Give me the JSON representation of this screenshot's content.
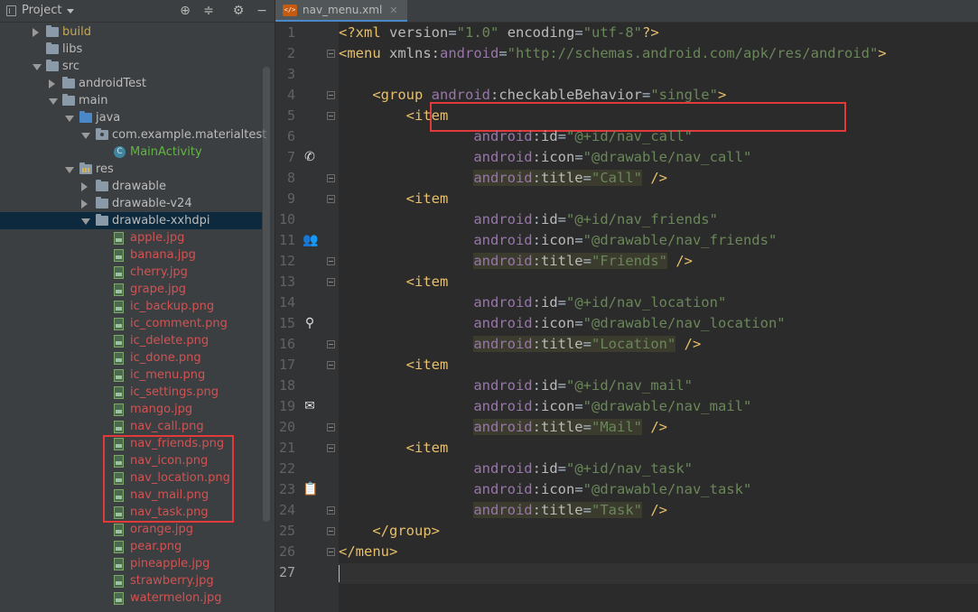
{
  "project_panel": {
    "title": "Project",
    "toolbar_icons": [
      "target-icon",
      "collapse-icon",
      "gear-icon",
      "hide-icon"
    ],
    "tree": [
      {
        "label": "build",
        "depth": 1,
        "arrow": "right",
        "icon": "folder",
        "color": "build"
      },
      {
        "label": "libs",
        "depth": 1,
        "arrow": "none",
        "icon": "folder",
        "color": "normal"
      },
      {
        "label": "src",
        "depth": 1,
        "arrow": "down",
        "icon": "folder",
        "color": "normal"
      },
      {
        "label": "androidTest",
        "depth": 2,
        "arrow": "right",
        "icon": "folder",
        "color": "normal"
      },
      {
        "label": "main",
        "depth": 2,
        "arrow": "down",
        "icon": "folder",
        "color": "normal"
      },
      {
        "label": "java",
        "depth": 3,
        "arrow": "down",
        "icon": "folder-blue",
        "color": "normal"
      },
      {
        "label": "com.example.materialtest",
        "depth": 4,
        "arrow": "down",
        "icon": "package",
        "color": "normal"
      },
      {
        "label": "MainActivity",
        "depth": 5,
        "arrow": "none",
        "icon": "class",
        "color": "green"
      },
      {
        "label": "res",
        "depth": 3,
        "arrow": "down",
        "icon": "folder-res",
        "color": "normal"
      },
      {
        "label": "drawable",
        "depth": 4,
        "arrow": "right",
        "icon": "folder",
        "color": "normal"
      },
      {
        "label": "drawable-v24",
        "depth": 4,
        "arrow": "right",
        "icon": "folder",
        "color": "normal"
      },
      {
        "label": "drawable-xxhdpi",
        "depth": 4,
        "arrow": "down",
        "icon": "folder",
        "color": "normal",
        "selected": true
      },
      {
        "label": "apple.jpg",
        "depth": 5,
        "arrow": "none",
        "icon": "image",
        "color": "file"
      },
      {
        "label": "banana.jpg",
        "depth": 5,
        "arrow": "none",
        "icon": "image",
        "color": "file"
      },
      {
        "label": "cherry.jpg",
        "depth": 5,
        "arrow": "none",
        "icon": "image",
        "color": "file"
      },
      {
        "label": "grape.jpg",
        "depth": 5,
        "arrow": "none",
        "icon": "image",
        "color": "file"
      },
      {
        "label": "ic_backup.png",
        "depth": 5,
        "arrow": "none",
        "icon": "image",
        "color": "file"
      },
      {
        "label": "ic_comment.png",
        "depth": 5,
        "arrow": "none",
        "icon": "image",
        "color": "file"
      },
      {
        "label": "ic_delete.png",
        "depth": 5,
        "arrow": "none",
        "icon": "image",
        "color": "file"
      },
      {
        "label": "ic_done.png",
        "depth": 5,
        "arrow": "none",
        "icon": "image",
        "color": "file"
      },
      {
        "label": "ic_menu.png",
        "depth": 5,
        "arrow": "none",
        "icon": "image",
        "color": "file"
      },
      {
        "label": "ic_settings.png",
        "depth": 5,
        "arrow": "none",
        "icon": "image",
        "color": "file"
      },
      {
        "label": "mango.jpg",
        "depth": 5,
        "arrow": "none",
        "icon": "image",
        "color": "file"
      },
      {
        "label": "nav_call.png",
        "depth": 5,
        "arrow": "none",
        "icon": "image",
        "color": "file"
      },
      {
        "label": "nav_friends.png",
        "depth": 5,
        "arrow": "none",
        "icon": "image",
        "color": "file"
      },
      {
        "label": "nav_icon.png",
        "depth": 5,
        "arrow": "none",
        "icon": "image",
        "color": "file"
      },
      {
        "label": "nav_location.png",
        "depth": 5,
        "arrow": "none",
        "icon": "image",
        "color": "file"
      },
      {
        "label": "nav_mail.png",
        "depth": 5,
        "arrow": "none",
        "icon": "image",
        "color": "file"
      },
      {
        "label": "nav_task.png",
        "depth": 5,
        "arrow": "none",
        "icon": "image",
        "color": "file"
      },
      {
        "label": "orange.jpg",
        "depth": 5,
        "arrow": "none",
        "icon": "image",
        "color": "file"
      },
      {
        "label": "pear.png",
        "depth": 5,
        "arrow": "none",
        "icon": "image",
        "color": "file"
      },
      {
        "label": "pineapple.jpg",
        "depth": 5,
        "arrow": "none",
        "icon": "image",
        "color": "file"
      },
      {
        "label": "strawberry.jpg",
        "depth": 5,
        "arrow": "none",
        "icon": "image",
        "color": "file"
      },
      {
        "label": "watermelon.jpg",
        "depth": 5,
        "arrow": "none",
        "icon": "image",
        "color": "file"
      }
    ]
  },
  "editor": {
    "tab": {
      "label": "nav_menu.xml",
      "icon": "xml-file-icon"
    },
    "current_line": 27,
    "lines": [
      {
        "n": 1,
        "segs": [
          [
            "p",
            "<?xml "
          ],
          [
            "a",
            "version"
          ],
          [
            "g",
            "="
          ],
          [
            "v",
            "\"1.0\""
          ],
          [
            "g",
            " "
          ],
          [
            "a",
            "encoding"
          ],
          [
            "g",
            "="
          ],
          [
            "v",
            "\"utf-8\""
          ],
          [
            "p",
            "?>"
          ]
        ]
      },
      {
        "n": 2,
        "fold": true,
        "segs": [
          [
            "t",
            "<menu "
          ],
          [
            "a",
            "xmlns:"
          ],
          [
            "ns",
            "android"
          ],
          [
            "g",
            "="
          ],
          [
            "v",
            "\"http://schemas.android.com/apk/res/android\""
          ],
          [
            "t",
            ">"
          ]
        ]
      },
      {
        "n": 3,
        "segs": []
      },
      {
        "n": 4,
        "fold": true,
        "segs": [
          [
            "g",
            "    "
          ],
          [
            "t",
            "<group "
          ],
          [
            "ns",
            "android"
          ],
          [
            "g",
            ":"
          ],
          [
            "a",
            "checkableBehavior"
          ],
          [
            "g",
            "="
          ],
          [
            "v",
            "\"single\""
          ],
          [
            "t",
            ">"
          ]
        ]
      },
      {
        "n": 5,
        "fold": true,
        "segs": [
          [
            "g",
            "        "
          ],
          [
            "t",
            "<item"
          ]
        ]
      },
      {
        "n": 6,
        "segs": [
          [
            "g",
            "                "
          ],
          [
            "ns",
            "android"
          ],
          [
            "g",
            ":"
          ],
          [
            "a",
            "id"
          ],
          [
            "g",
            "="
          ],
          [
            "v",
            "\"@+id/nav_call\""
          ]
        ]
      },
      {
        "n": 7,
        "icon": "phone-icon",
        "segs": [
          [
            "g",
            "                "
          ],
          [
            "ns",
            "android"
          ],
          [
            "g",
            ":"
          ],
          [
            "a",
            "icon"
          ],
          [
            "g",
            "="
          ],
          [
            "v",
            "\"@drawable/nav_call\""
          ]
        ]
      },
      {
        "n": 8,
        "fold": true,
        "segs": [
          [
            "g",
            "                "
          ],
          [
            "hl",
            "android:title=\"Call\""
          ],
          [
            "g",
            " "
          ],
          [
            "t",
            "/>"
          ]
        ],
        "title_attr": "Call"
      },
      {
        "n": 9,
        "fold": true,
        "segs": [
          [
            "g",
            "        "
          ],
          [
            "t",
            "<item"
          ]
        ]
      },
      {
        "n": 10,
        "segs": [
          [
            "g",
            "                "
          ],
          [
            "ns",
            "android"
          ],
          [
            "g",
            ":"
          ],
          [
            "a",
            "id"
          ],
          [
            "g",
            "="
          ],
          [
            "v",
            "\"@+id/nav_friends\""
          ]
        ]
      },
      {
        "n": 11,
        "icon": "people-icon",
        "segs": [
          [
            "g",
            "                "
          ],
          [
            "ns",
            "android"
          ],
          [
            "g",
            ":"
          ],
          [
            "a",
            "icon"
          ],
          [
            "g",
            "="
          ],
          [
            "v",
            "\"@drawable/nav_friends\""
          ]
        ]
      },
      {
        "n": 12,
        "fold": true,
        "segs": [
          [
            "g",
            "                "
          ],
          [
            "hl",
            "android:title=\"Friends\""
          ],
          [
            "g",
            " "
          ],
          [
            "t",
            "/>"
          ]
        ],
        "title_attr": "Friends"
      },
      {
        "n": 13,
        "fold": true,
        "segs": [
          [
            "g",
            "        "
          ],
          [
            "t",
            "<item"
          ]
        ]
      },
      {
        "n": 14,
        "segs": [
          [
            "g",
            "                "
          ],
          [
            "ns",
            "android"
          ],
          [
            "g",
            ":"
          ],
          [
            "a",
            "id"
          ],
          [
            "g",
            "="
          ],
          [
            "v",
            "\"@+id/nav_location\""
          ]
        ]
      },
      {
        "n": 15,
        "icon": "location-pin-icon",
        "segs": [
          [
            "g",
            "                "
          ],
          [
            "ns",
            "android"
          ],
          [
            "g",
            ":"
          ],
          [
            "a",
            "icon"
          ],
          [
            "g",
            "="
          ],
          [
            "v",
            "\"@drawable/nav_location\""
          ]
        ]
      },
      {
        "n": 16,
        "fold": true,
        "segs": [
          [
            "g",
            "                "
          ],
          [
            "hl",
            "android:title=\"Location\""
          ],
          [
            "g",
            " "
          ],
          [
            "t",
            "/>"
          ]
        ],
        "title_attr": "Location"
      },
      {
        "n": 17,
        "fold": true,
        "segs": [
          [
            "g",
            "        "
          ],
          [
            "t",
            "<item"
          ]
        ]
      },
      {
        "n": 18,
        "segs": [
          [
            "g",
            "                "
          ],
          [
            "ns",
            "android"
          ],
          [
            "g",
            ":"
          ],
          [
            "a",
            "id"
          ],
          [
            "g",
            "="
          ],
          [
            "v",
            "\"@+id/nav_mail\""
          ]
        ]
      },
      {
        "n": 19,
        "icon": "mail-icon",
        "segs": [
          [
            "g",
            "                "
          ],
          [
            "ns",
            "android"
          ],
          [
            "g",
            ":"
          ],
          [
            "a",
            "icon"
          ],
          [
            "g",
            "="
          ],
          [
            "v",
            "\"@drawable/nav_mail\""
          ]
        ]
      },
      {
        "n": 20,
        "fold": true,
        "segs": [
          [
            "g",
            "                "
          ],
          [
            "hl",
            "android:title=\"Mail\""
          ],
          [
            "g",
            " "
          ],
          [
            "t",
            "/>"
          ]
        ],
        "title_attr": "Mail"
      },
      {
        "n": 21,
        "fold": true,
        "segs": [
          [
            "g",
            "        "
          ],
          [
            "t",
            "<item"
          ]
        ]
      },
      {
        "n": 22,
        "segs": [
          [
            "g",
            "                "
          ],
          [
            "ns",
            "android"
          ],
          [
            "g",
            ":"
          ],
          [
            "a",
            "id"
          ],
          [
            "g",
            "="
          ],
          [
            "v",
            "\"@+id/nav_task\""
          ]
        ]
      },
      {
        "n": 23,
        "icon": "clipboard-icon",
        "segs": [
          [
            "g",
            "                "
          ],
          [
            "ns",
            "android"
          ],
          [
            "g",
            ":"
          ],
          [
            "a",
            "icon"
          ],
          [
            "g",
            "="
          ],
          [
            "v",
            "\"@drawable/nav_task\""
          ]
        ]
      },
      {
        "n": 24,
        "fold": true,
        "segs": [
          [
            "g",
            "                "
          ],
          [
            "hl",
            "android:title=\"Task\""
          ],
          [
            "g",
            " "
          ],
          [
            "t",
            "/>"
          ]
        ],
        "title_attr": "Task"
      },
      {
        "n": 25,
        "fold": true,
        "segs": [
          [
            "g",
            "    "
          ],
          [
            "t",
            "</group>"
          ]
        ]
      },
      {
        "n": 26,
        "fold": true,
        "segs": [
          [
            "t",
            "</menu>"
          ]
        ]
      },
      {
        "n": 27,
        "segs": []
      }
    ]
  },
  "colors": {
    "background": "#2b2b2b",
    "tag": "#e8bf6a",
    "namespace": "#9876aa",
    "attribute": "#bababa",
    "value": "#6a8759",
    "highlight_box": "#e03a3a"
  }
}
